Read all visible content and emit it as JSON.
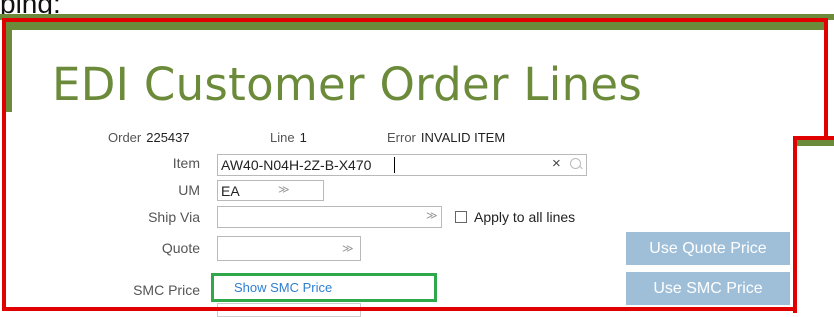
{
  "header": {
    "caption_partial": "ping:",
    "title": "EDI Customer Order Lines"
  },
  "info": {
    "order_label": "Order",
    "order_value": "225437",
    "line_label": "Line",
    "line_value": "1",
    "error_label": "Error",
    "error_value": "INVALID ITEM"
  },
  "form": {
    "item_label": "Item",
    "item_value": "AW40-N04H-2Z-B-X470",
    "um_label": "UM",
    "um_value": "EA",
    "shipvia_label": "Ship Via",
    "shipvia_value": "",
    "apply_all_label": "Apply to all lines",
    "quote_label": "Quote",
    "quote_value": "",
    "smc_label": "SMC Price",
    "smc_link": "Show SMC Price"
  },
  "buttons": {
    "use_quote_price": "Use Quote Price",
    "use_smc_price": "Use SMC Price"
  },
  "icons": {
    "clear": "close-icon",
    "search": "search-icon",
    "dropdown": "chevron-down-icon"
  },
  "colors": {
    "title_green": "#6b8a3a",
    "highlight_red": "#e10000",
    "highlight_green": "#2ea84a",
    "button_blue": "#9fbfd9",
    "link_blue": "#2e7fd0"
  }
}
